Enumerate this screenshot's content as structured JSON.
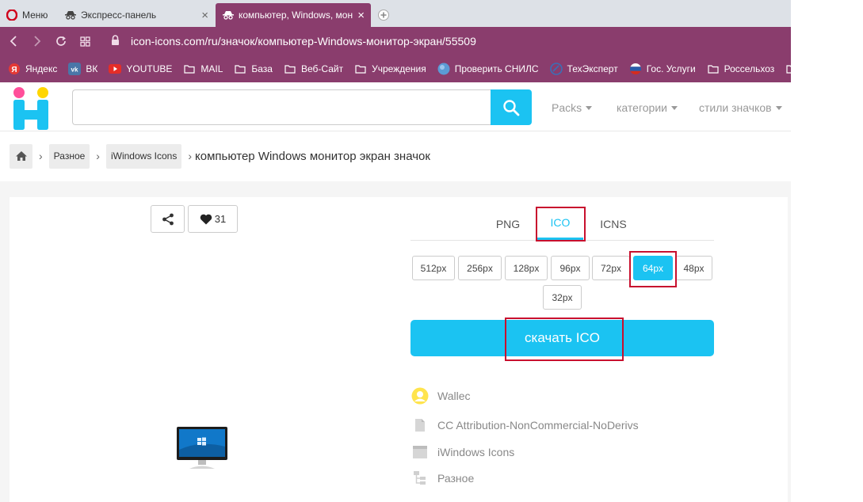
{
  "browser": {
    "menu_label": "Меню",
    "tabs": [
      {
        "label": "Экспресс-панель"
      },
      {
        "label": "компьютер, Windows, мон"
      }
    ],
    "url": "icon-icons.com/ru/значок/компьютер-Windows-монитор-экран/55509",
    "bookmarks": [
      {
        "label": "Яндекс",
        "icon": "yandex-icon"
      },
      {
        "label": "ВК",
        "icon": "vk-icon"
      },
      {
        "label": "YOUTUBE",
        "icon": "youtube-icon"
      },
      {
        "label": "MAIL",
        "icon": "folder-icon"
      },
      {
        "label": "База",
        "icon": "folder-icon"
      },
      {
        "label": "Веб-Сайт",
        "icon": "folder-icon"
      },
      {
        "label": "Учреждения",
        "icon": "folder-icon"
      },
      {
        "label": "Проверить СНИЛС",
        "icon": "globe-icon"
      },
      {
        "label": "ТехЭксперт",
        "icon": "techexpert-icon"
      },
      {
        "label": "Гос. Услуги",
        "icon": "gosuslugi-icon"
      },
      {
        "label": "Россельхоз",
        "icon": "folder-icon"
      }
    ]
  },
  "site": {
    "search": {
      "value": "",
      "placeholder": ""
    },
    "nav": {
      "packs": "Packs",
      "categories": "категории",
      "styles": "стили значков"
    }
  },
  "breadcrumb": {
    "items": [
      "Разное",
      "iWindows Icons"
    ],
    "current": "компьютер Windows монитор экран значок"
  },
  "icon_page": {
    "favorites_count": "31",
    "formats": [
      "PNG",
      "ICO",
      "ICNS"
    ],
    "active_format": "ICO",
    "sizes": [
      "512px",
      "256px",
      "128px",
      "96px",
      "72px",
      "64px",
      "48px",
      "32px"
    ],
    "active_size": "64px",
    "download_label": "скачать ICO",
    "meta": {
      "author": "Wallec",
      "license": "CC Attribution-NonCommercial-NoDerivs",
      "pack": "iWindows Icons",
      "category": "Разное"
    }
  },
  "colors": {
    "accent": "#1bc3f2",
    "browser_chrome": "#8a3d6d",
    "highlight": "#c8102e"
  }
}
